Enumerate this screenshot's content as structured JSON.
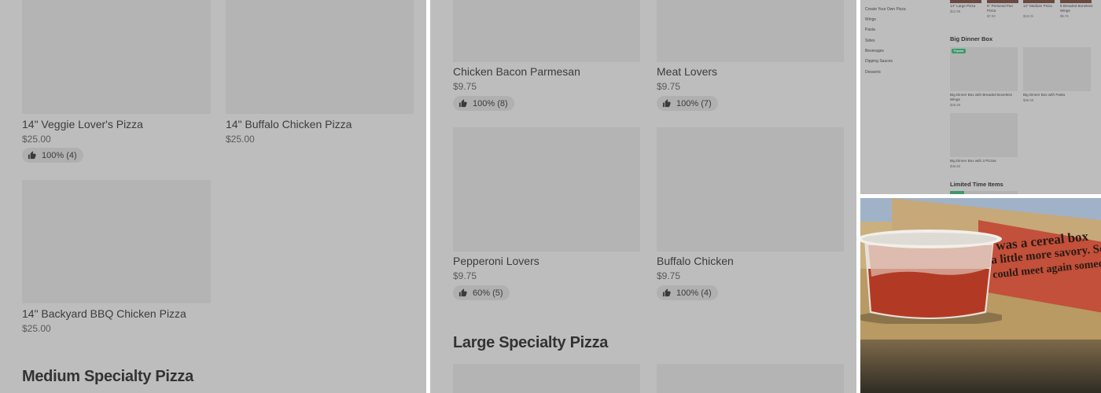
{
  "panel1": {
    "items": [
      {
        "name": "14\" Veggie Lover's Pizza",
        "price": "$25.00",
        "rating": "100% (4)"
      },
      {
        "name": "14\" Buffalo Chicken Pizza",
        "price": "$25.00"
      },
      {
        "name": "14\" Backyard BBQ Chicken Pizza",
        "price": "$25.00"
      }
    ],
    "section_heading": "Medium Specialty Pizza"
  },
  "panel2": {
    "items": [
      {
        "name": "Chicken Bacon Parmesan",
        "price": "$9.75",
        "rating": "100% (8)"
      },
      {
        "name": "Meat Lovers",
        "price": "$9.75",
        "rating": "100% (7)"
      },
      {
        "name": "Pepperoni Lovers",
        "price": "$9.75",
        "rating": "60% (5)"
      },
      {
        "name": "Buffalo Chicken",
        "price": "$9.75",
        "rating": "100% (4)"
      }
    ],
    "section_heading": "Large Specialty Pizza"
  },
  "panel3": {
    "sidebar": [
      "Create Your Own Pizza",
      "Wings",
      "Pasta",
      "Sides",
      "Beverages",
      "Dipping Sauces",
      "Desserts"
    ],
    "top_items": [
      {
        "name": "14\" Large Pizza",
        "price": "$22.95"
      },
      {
        "name": "6\" Personal Pan Pizza",
        "price": "$7.92"
      },
      {
        "name": "12\" Medium Pizza",
        "price": "$19.01"
      },
      {
        "name": "8 Breaded Boneless Wings",
        "price": "$9.75"
      }
    ],
    "section_big_dinner": "Big Dinner Box",
    "popular_tag": "Popular",
    "big_dinner_items": [
      {
        "name": "Big Dinner Box with Breaded Boneless Wings",
        "price": "$36.59"
      },
      {
        "name": "Big Dinner Box with Pasta",
        "price": "$36.59"
      },
      {
        "name": "Big Dinner Box with 3 Pizzas",
        "price": "$36.60"
      }
    ],
    "section_limited": "Limited Time Items"
  },
  "panel4": {
    "box_text_line1": "was a cereal box",
    "box_text_line2": "a little more savory. So",
    "box_text_line3": "could meet again someda"
  },
  "colors": {
    "overlay_gray": "#bdbdbd",
    "popular_green": "#3c9a6a",
    "pizza_box_red": "#c2503a"
  }
}
